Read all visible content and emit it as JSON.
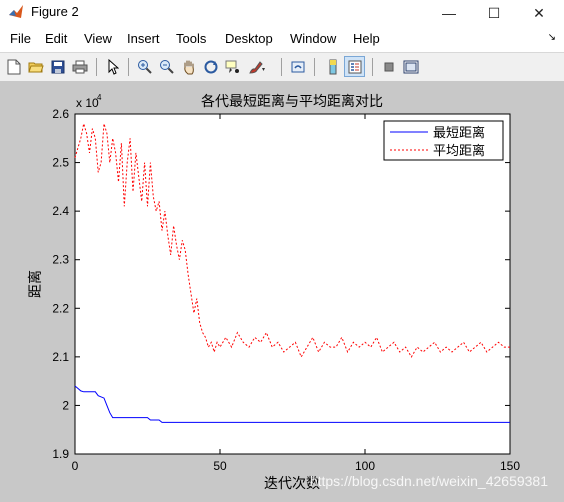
{
  "window": {
    "title": "Figure 2",
    "minimize_label": "—",
    "maximize_label": "☐",
    "close_label": "✕"
  },
  "menubar": {
    "items": [
      "File",
      "Edit",
      "View",
      "Insert",
      "Tools",
      "Desktop",
      "Window",
      "Help"
    ],
    "dock_arrow": "↘"
  },
  "toolbar": {
    "buttons": [
      "new-figure",
      "open-file",
      "save-figure",
      "print-figure",
      "edit-plot-arrow",
      "zoom-in",
      "zoom-out",
      "pan-hand",
      "rotate-3d",
      "data-cursor",
      "brush",
      "link-plot",
      "colorbar",
      "legend",
      "hide-plot-tools",
      "show-plot-tools"
    ]
  },
  "chart_data": {
    "type": "line",
    "title": "各代最短距离与平均距离对比",
    "xlabel": "迭代次数",
    "ylabel": "距离",
    "y_exponent_label": "x 10",
    "y_exponent_power": "4",
    "xlim": [
      0,
      150
    ],
    "ylim": [
      1.9,
      2.6
    ],
    "x_ticks": [
      "0",
      "50",
      "100",
      "150"
    ],
    "y_ticks": [
      "1.9",
      "2",
      "2.1",
      "2.2",
      "2.3",
      "2.4",
      "2.5",
      "2.6"
    ],
    "legend_position": "top-right",
    "series": [
      {
        "name": "最短距离",
        "color": "#0000ff",
        "style": "solid",
        "x": [
          0,
          1,
          2,
          3,
          7,
          8,
          10,
          11,
          12,
          13,
          25,
          26,
          29,
          30,
          150
        ],
        "y": [
          2.04,
          2.035,
          2.03,
          2.028,
          2.028,
          2.02,
          2.015,
          2.0,
          1.985,
          1.975,
          1.975,
          1.97,
          1.97,
          1.965,
          1.965
        ]
      },
      {
        "name": "平均距离",
        "color": "#ff0000",
        "style": "dashed",
        "x": [
          0,
          1,
          2,
          3,
          4,
          5,
          6,
          7,
          8,
          9,
          10,
          11,
          12,
          13,
          14,
          15,
          16,
          17,
          18,
          19,
          20,
          21,
          22,
          23,
          24,
          25,
          26,
          27,
          28,
          29,
          30,
          31,
          32,
          33,
          34,
          35,
          36,
          37,
          38,
          39,
          40,
          41,
          42,
          43,
          44,
          45,
          46,
          47,
          48,
          49,
          50,
          52,
          54,
          56,
          58,
          60,
          62,
          64,
          66,
          68,
          70,
          72,
          74,
          76,
          78,
          80,
          82,
          84,
          86,
          88,
          90,
          92,
          94,
          96,
          98,
          100,
          102,
          104,
          106,
          108,
          110,
          112,
          114,
          116,
          118,
          120,
          122,
          124,
          126,
          128,
          130,
          132,
          134,
          136,
          138,
          140,
          142,
          144,
          146,
          148,
          150
        ],
        "y": [
          2.51,
          2.53,
          2.55,
          2.58,
          2.56,
          2.52,
          2.57,
          2.55,
          2.48,
          2.5,
          2.58,
          2.56,
          2.5,
          2.55,
          2.52,
          2.46,
          2.54,
          2.41,
          2.5,
          2.55,
          2.44,
          2.52,
          2.47,
          2.42,
          2.5,
          2.41,
          2.5,
          2.43,
          2.4,
          2.42,
          2.36,
          2.4,
          2.35,
          2.31,
          2.37,
          2.33,
          2.3,
          2.34,
          2.32,
          2.27,
          2.23,
          2.19,
          2.22,
          2.17,
          2.15,
          2.14,
          2.12,
          2.13,
          2.11,
          2.13,
          2.12,
          2.14,
          2.12,
          2.15,
          2.13,
          2.12,
          2.14,
          2.13,
          2.15,
          2.12,
          2.13,
          2.11,
          2.12,
          2.13,
          2.1,
          2.12,
          2.14,
          2.11,
          2.13,
          2.12,
          2.12,
          2.14,
          2.11,
          2.13,
          2.12,
          2.13,
          2.12,
          2.14,
          2.11,
          2.12,
          2.13,
          2.11,
          2.12,
          2.1,
          2.12,
          2.11,
          2.12,
          2.13,
          2.11,
          2.12,
          2.11,
          2.12,
          2.13,
          2.11,
          2.12,
          2.13,
          2.11,
          2.12,
          2.13,
          2.12,
          2.12
        ]
      }
    ]
  },
  "watermark": "https://blog.csdn.net/weixin_42659381"
}
